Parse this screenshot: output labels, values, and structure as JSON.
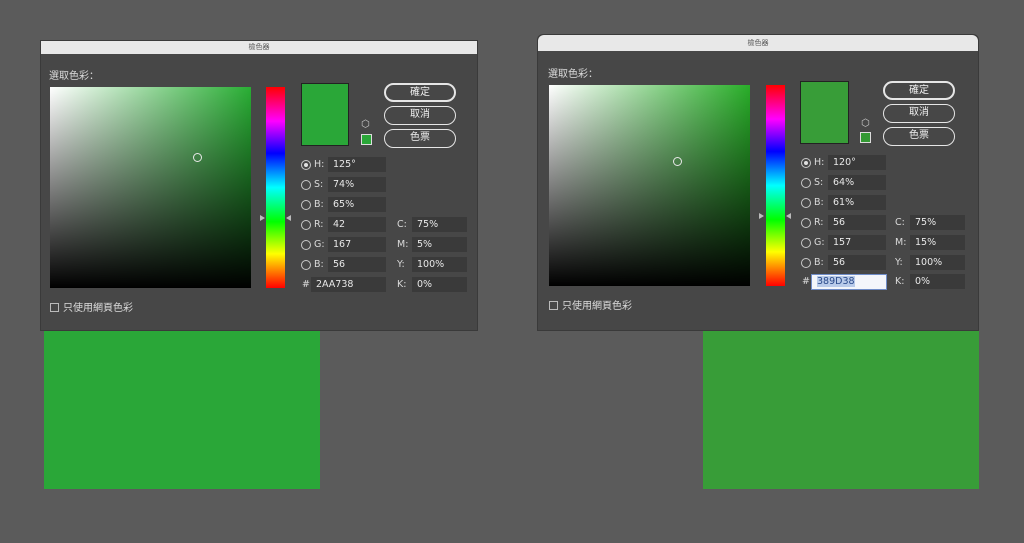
{
  "left_dialog": {
    "title": "檢色器",
    "pick_label": "選取色彩：",
    "preview_color": "#2AA738",
    "buttons": {
      "ok": "確定",
      "cancel": "取消",
      "swatches": "色票"
    },
    "fields": {
      "h": {
        "label": "H:",
        "value": "125°",
        "selected": true
      },
      "s": {
        "label": "S:",
        "value": "74%"
      },
      "b": {
        "label": "B:",
        "value": "65%"
      },
      "r": {
        "label": "R:",
        "value": "42"
      },
      "g": {
        "label": "G:",
        "value": "167"
      },
      "bl": {
        "label": "B:",
        "value": "56"
      },
      "c": {
        "label": "C:",
        "value": "75%"
      },
      "m": {
        "label": "M:",
        "value": "5%"
      },
      "y": {
        "label": "Y:",
        "value": "100%"
      },
      "k": {
        "label": "K:",
        "value": "0%"
      },
      "hash": "#",
      "hex": "2AA738"
    },
    "web_only_label": "只使用網頁色彩",
    "result_swatch_color": "#2AA738"
  },
  "right_dialog": {
    "title": "檢色器",
    "pick_label": "選取色彩：",
    "preview_color": "#389D38",
    "buttons": {
      "ok": "確定",
      "cancel": "取消",
      "swatches": "色票"
    },
    "fields": {
      "h": {
        "label": "H:",
        "value": "120°",
        "selected": true
      },
      "s": {
        "label": "S:",
        "value": "64%"
      },
      "b": {
        "label": "B:",
        "value": "61%"
      },
      "r": {
        "label": "R:",
        "value": "56"
      },
      "g": {
        "label": "G:",
        "value": "157"
      },
      "bl": {
        "label": "B:",
        "value": "56"
      },
      "c": {
        "label": "C:",
        "value": "75%"
      },
      "m": {
        "label": "M:",
        "value": "15%"
      },
      "y": {
        "label": "Y:",
        "value": "100%"
      },
      "k": {
        "label": "K:",
        "value": "0%"
      },
      "hash": "#",
      "hex": "389D38"
    },
    "web_only_label": "只使用網頁色彩",
    "result_swatch_color": "#389D38"
  },
  "icons": {
    "cube": "cube-icon",
    "checkbox": "checkbox-icon",
    "radio": "radio-icon"
  }
}
